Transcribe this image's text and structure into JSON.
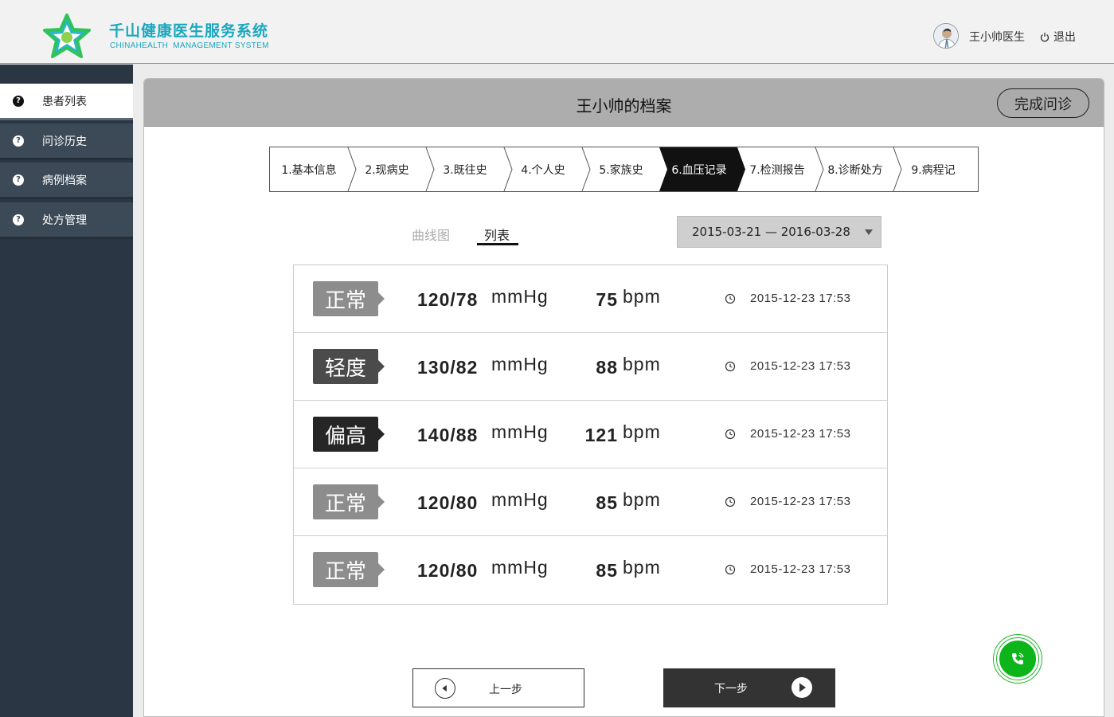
{
  "header": {
    "brand_cn": "千山健康医生服务系统",
    "brand_en": "CHINAHEALTH  MANAGEMENT SYSTEM",
    "doctor_name": "王小帅医生",
    "logout_label": "退出",
    "logo_icon": "star-logo-icon",
    "brand_color": "#1aa7bf"
  },
  "sidebar": {
    "items": [
      {
        "label": "患者列表",
        "active": true
      },
      {
        "label": "问诊历史",
        "active": false
      },
      {
        "label": "病例档案",
        "active": false
      },
      {
        "label": "处方管理",
        "active": false
      }
    ]
  },
  "panel": {
    "title": "王小帅的档案",
    "finish_label": "完成问诊"
  },
  "steps": [
    "1.基本信息",
    "2.现病史",
    "3.既往史",
    "4.个人史",
    "5.家族史",
    "6.血压记录",
    "7.检测报告",
    "8.诊断处方",
    "9.病程记"
  ],
  "active_step": 5,
  "tabs": {
    "curve_label": "曲线图",
    "list_label": "列表",
    "active": "列表"
  },
  "date_range": "2015-03-21 — 2016-03-28",
  "records": [
    {
      "status": "正常",
      "level": "normal",
      "bp": "120/78",
      "bp_unit": "mmHg",
      "hr": "75",
      "hr_unit": "bpm",
      "time": "2015-12-23 17:53"
    },
    {
      "status": "轻度",
      "level": "mild",
      "bp": "130/82",
      "bp_unit": "mmHg",
      "hr": "88",
      "hr_unit": "bpm",
      "time": "2015-12-23 17:53"
    },
    {
      "status": "偏高",
      "level": "high",
      "bp": "140/88",
      "bp_unit": "mmHg",
      "hr": "121",
      "hr_unit": "bpm",
      "time": "2015-12-23 17:53"
    },
    {
      "status": "正常",
      "level": "normal",
      "bp": "120/80",
      "bp_unit": "mmHg",
      "hr": "85",
      "hr_unit": "bpm",
      "time": "2015-12-23 17:53"
    },
    {
      "status": "正常",
      "level": "normal",
      "bp": "120/80",
      "bp_unit": "mmHg",
      "hr": "85",
      "hr_unit": "bpm",
      "time": "2015-12-23 17:53"
    }
  ],
  "nav": {
    "prev_label": "上一步",
    "next_label": "下一步"
  },
  "call_color": "#0db51a"
}
